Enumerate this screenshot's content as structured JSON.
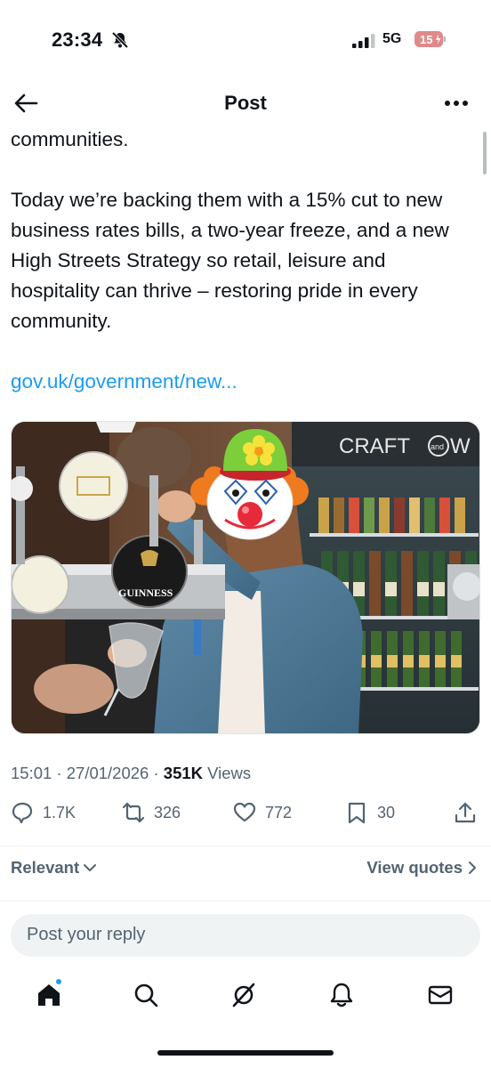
{
  "status_bar": {
    "time": "23:34",
    "network": "5G",
    "battery": "15",
    "icons": [
      "bell-slash-icon",
      "signal-icon",
      "battery-icon"
    ]
  },
  "header": {
    "title": "Post",
    "back_icon": "arrow-left-icon",
    "more_icon": "more-horizontal-icon"
  },
  "post": {
    "text_fragment": "communities.",
    "paragraph": "Today we’re backing them with a 15% cut to new business rates bills, a two-year freeze, and a new High Streets Strategy so retail, leisure and hospitality can thrive – restoring pride in every community.",
    "link": "gov.uk/government/new...",
    "image_sign": "CRAFT",
    "image_sign_small": "and",
    "image_sign_tail": "W",
    "image_tap_label": "GUINNESS",
    "timestamp": "15:01 · 27/01/2026 · ",
    "views_count": "351K",
    "views_label": " Views"
  },
  "actions": {
    "replies": "1.7K",
    "reposts": "326",
    "likes": "772",
    "bookmarks": "30"
  },
  "sort": {
    "relevant": "Relevant",
    "view_quotes": "View quotes"
  },
  "reply": {
    "placeholder": "Post your reply"
  },
  "colors": {
    "accent": "#1d9bf0",
    "text": "#0f1419",
    "muted": "#536471"
  }
}
